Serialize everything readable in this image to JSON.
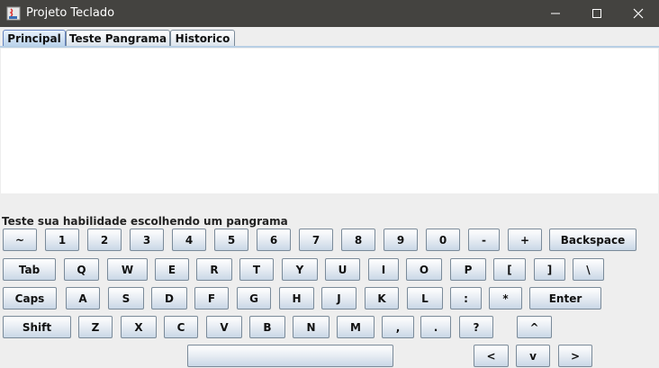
{
  "window": {
    "title": "Projeto Teclado"
  },
  "tabs": [
    "Principal",
    "Teste Pangrama",
    "Historico"
  ],
  "hint": "Teste sua habilidade escolhendo um pangrama",
  "keys": {
    "row1": [
      "~",
      "1",
      "2",
      "3",
      "4",
      "5",
      "6",
      "7",
      "8",
      "9",
      "0",
      "-",
      "+",
      "Backspace"
    ],
    "row2": [
      "Tab",
      "Q",
      "W",
      "E",
      "R",
      "T",
      "Y",
      "U",
      "I",
      "O",
      "P",
      "[",
      "]",
      "\\"
    ],
    "row3": [
      "Caps",
      "A",
      "S",
      "D",
      "F",
      "G",
      "H",
      "J",
      "K",
      "L",
      ":",
      "*",
      "Enter"
    ],
    "row4": [
      "Shift",
      "Z",
      "X",
      "C",
      "V",
      "B",
      "N",
      "M",
      ",",
      ".",
      "?",
      "^"
    ],
    "row5": [
      "",
      "<",
      "v",
      ">"
    ]
  },
  "colors": {
    "titlebar": "#444340",
    "active_tab": "#b8d1ea"
  }
}
